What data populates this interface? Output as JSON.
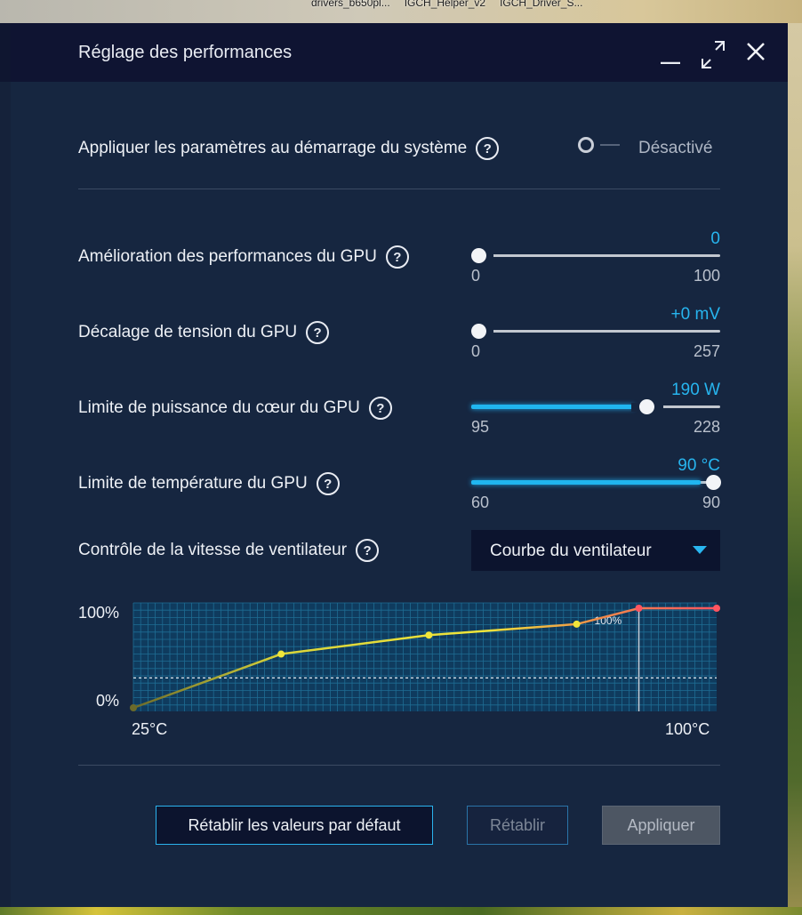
{
  "desktop": {
    "files": [
      "drivers_b650pl...",
      "IGCH_Helper_v2",
      "IGCH_Driver_S..."
    ]
  },
  "window": {
    "title": "Réglage des performances",
    "controls": {
      "minimize_icon": "minimize-icon",
      "maximize_icon": "maximize-icon",
      "close_icon": "close-icon"
    }
  },
  "startup": {
    "label": "Appliquer les paramètres au démarrage du système",
    "toggle_state": "Désactivé",
    "enabled": false
  },
  "sliders": [
    {
      "label": "Amélioration des performances du GPU",
      "value_text": "0",
      "min": "0",
      "max": "100",
      "value": 0,
      "min_num": 0,
      "max_num": 100
    },
    {
      "label": "Décalage de tension du GPU",
      "value_text": "+0 mV",
      "min": "0",
      "max": "257",
      "value": 0,
      "min_num": 0,
      "max_num": 257
    },
    {
      "label": "Limite de puissance du cœur du GPU",
      "value_text": "190 W",
      "min": "95",
      "max": "228",
      "value": 190,
      "min_num": 95,
      "max_num": 228
    },
    {
      "label": "Limite de température du GPU",
      "value_text": "90 °C",
      "min": "60",
      "max": "90",
      "value": 90,
      "min_num": 60,
      "max_num": 90
    }
  ],
  "fan": {
    "label": "Contrôle de la vitesse de ventilateur",
    "mode": "Courbe du ventilateur",
    "chart": {
      "y_top_label": "100%",
      "y_bottom_label": "0%",
      "x_left_label": "25°C",
      "x_right_label": "100°C",
      "marker_label": "100%"
    }
  },
  "chart_data": {
    "type": "line",
    "x": [
      25,
      44,
      63,
      82,
      90,
      100
    ],
    "y": [
      0,
      54,
      73,
      84,
      100,
      100
    ],
    "xlim": [
      25,
      100
    ],
    "ylim": [
      0,
      100
    ],
    "marker_x": 90,
    "dashed_y": 30,
    "colors": {
      "low": "#6b6a2a",
      "mid": "#f1e63a",
      "high": "#ff5560",
      "grid": "#1e6d93",
      "plot_bg": "#0f3b5e"
    }
  },
  "buttons": {
    "reset_defaults": "Rétablir les valeurs par défaut",
    "restore": "Rétablir",
    "apply": "Appliquer"
  },
  "colors": {
    "accent": "#27b5ef",
    "panel_bg": "#162640",
    "titlebar_bg": "#0f1432"
  }
}
